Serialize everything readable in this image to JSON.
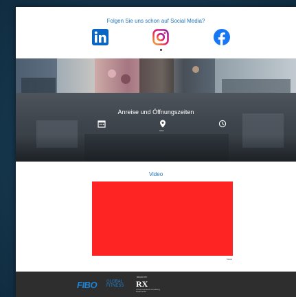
{
  "social": {
    "title": "Folgen Sie uns schon auf Social Media?",
    "icons": [
      "linkedin-icon",
      "instagram-icon",
      "facebook-icon"
    ]
  },
  "visit": {
    "title": "Anreise und Öffnungszeiten",
    "pin_caption": "OAS"
  },
  "video": {
    "title": "Video",
    "caption": "Kanal"
  },
  "footer": {
    "fibo_logo": "FIBO",
    "fibo_tagline_1": "GLOBAL",
    "fibo_tagline_2": "FITNESS",
    "rx_top": "BRAND BY",
    "rx_logo": "RX",
    "rx_tagline": "In the business of building businesses"
  },
  "colors": {
    "accent_blue": "#1f73b8",
    "video_red": "#ff2424",
    "footer_bg": "#2e2e2e",
    "page_bg": "#173a52"
  }
}
